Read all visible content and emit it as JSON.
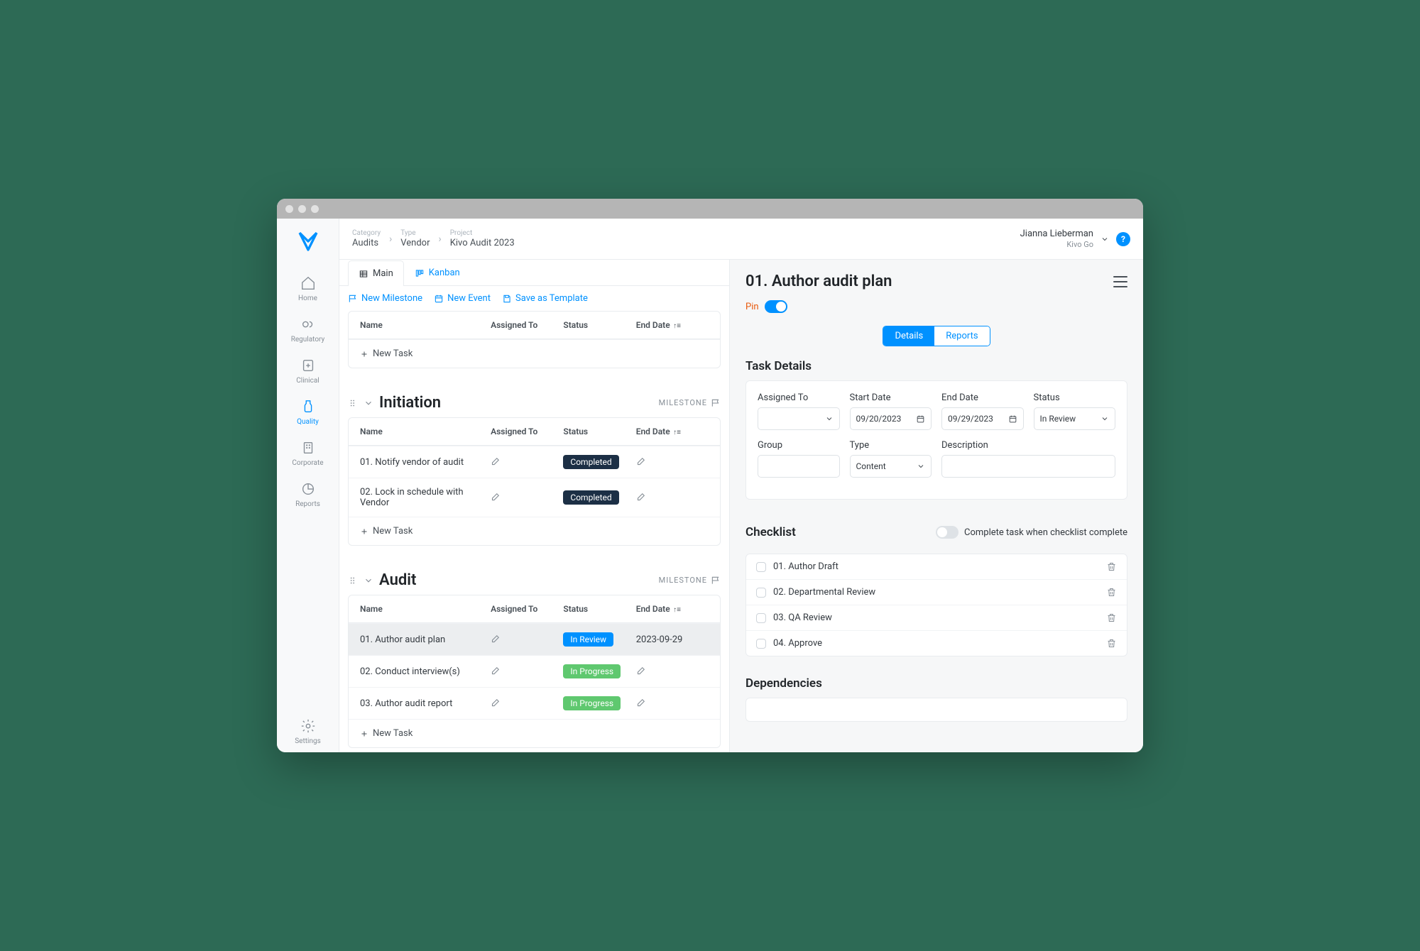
{
  "breadcrumb": [
    {
      "label": "Category",
      "value": "Audits"
    },
    {
      "label": "Type",
      "value": "Vendor"
    },
    {
      "label": "Project",
      "value": "Kivo Audit 2023"
    }
  ],
  "user": {
    "name": "Jianna Lieberman",
    "org": "Kivo Go"
  },
  "sidebar": {
    "items": [
      {
        "label": "Home"
      },
      {
        "label": "Regulatory"
      },
      {
        "label": "Clinical"
      },
      {
        "label": "Quality"
      },
      {
        "label": "Corporate"
      },
      {
        "label": "Reports"
      }
    ],
    "settings": "Settings"
  },
  "tabs": {
    "main": "Main",
    "kanban": "Kanban"
  },
  "toolbar": {
    "newMilestone": "New Milestone",
    "newEvent": "New Event",
    "saveTemplate": "Save as Template"
  },
  "columns": {
    "name": "Name",
    "assignedTo": "Assigned To",
    "status": "Status",
    "endDate": "End Date"
  },
  "newTask": "New Task",
  "milestoneLabel": "MILESTONE",
  "sections": [
    {
      "title": "Initiation",
      "isMilestone": true,
      "tasks": [
        {
          "name": "01. Notify vendor of audit",
          "status": "Completed",
          "statusClass": "completed",
          "endDate": ""
        },
        {
          "name": "02. Lock in schedule with Vendor",
          "status": "Completed",
          "statusClass": "completed",
          "endDate": ""
        }
      ]
    },
    {
      "title": "Audit",
      "isMilestone": true,
      "tasks": [
        {
          "name": "01. Author audit plan",
          "status": "In Review",
          "statusClass": "inreview",
          "endDate": "2023-09-29",
          "selected": true
        },
        {
          "name": "02. Conduct interview(s)",
          "status": "In Progress",
          "statusClass": "inprogress",
          "endDate": ""
        },
        {
          "name": "03. Author audit report",
          "status": "In Progress",
          "statusClass": "inprogress",
          "endDate": ""
        }
      ]
    }
  ],
  "detail": {
    "title": "01. Author audit plan",
    "pinLabel": "Pin",
    "pinned": true,
    "tabs": {
      "details": "Details",
      "reports": "Reports"
    },
    "sectionTitle": "Task Details",
    "fields": {
      "assignedTo": {
        "label": "Assigned To",
        "value": ""
      },
      "startDate": {
        "label": "Start Date",
        "value": "09/20/2023"
      },
      "endDate": {
        "label": "End Date",
        "value": "09/29/2023"
      },
      "status": {
        "label": "Status",
        "value": "In Review"
      },
      "group": {
        "label": "Group",
        "value": ""
      },
      "type": {
        "label": "Type",
        "value": "Content"
      },
      "description": {
        "label": "Description",
        "value": ""
      }
    },
    "checklist": {
      "title": "Checklist",
      "completeOption": "Complete task when checklist complete",
      "items": [
        "01. Author Draft",
        "02. Departmental Review",
        "03. QA Review",
        "04. Approve"
      ]
    },
    "dependencies": {
      "title": "Dependencies"
    }
  }
}
